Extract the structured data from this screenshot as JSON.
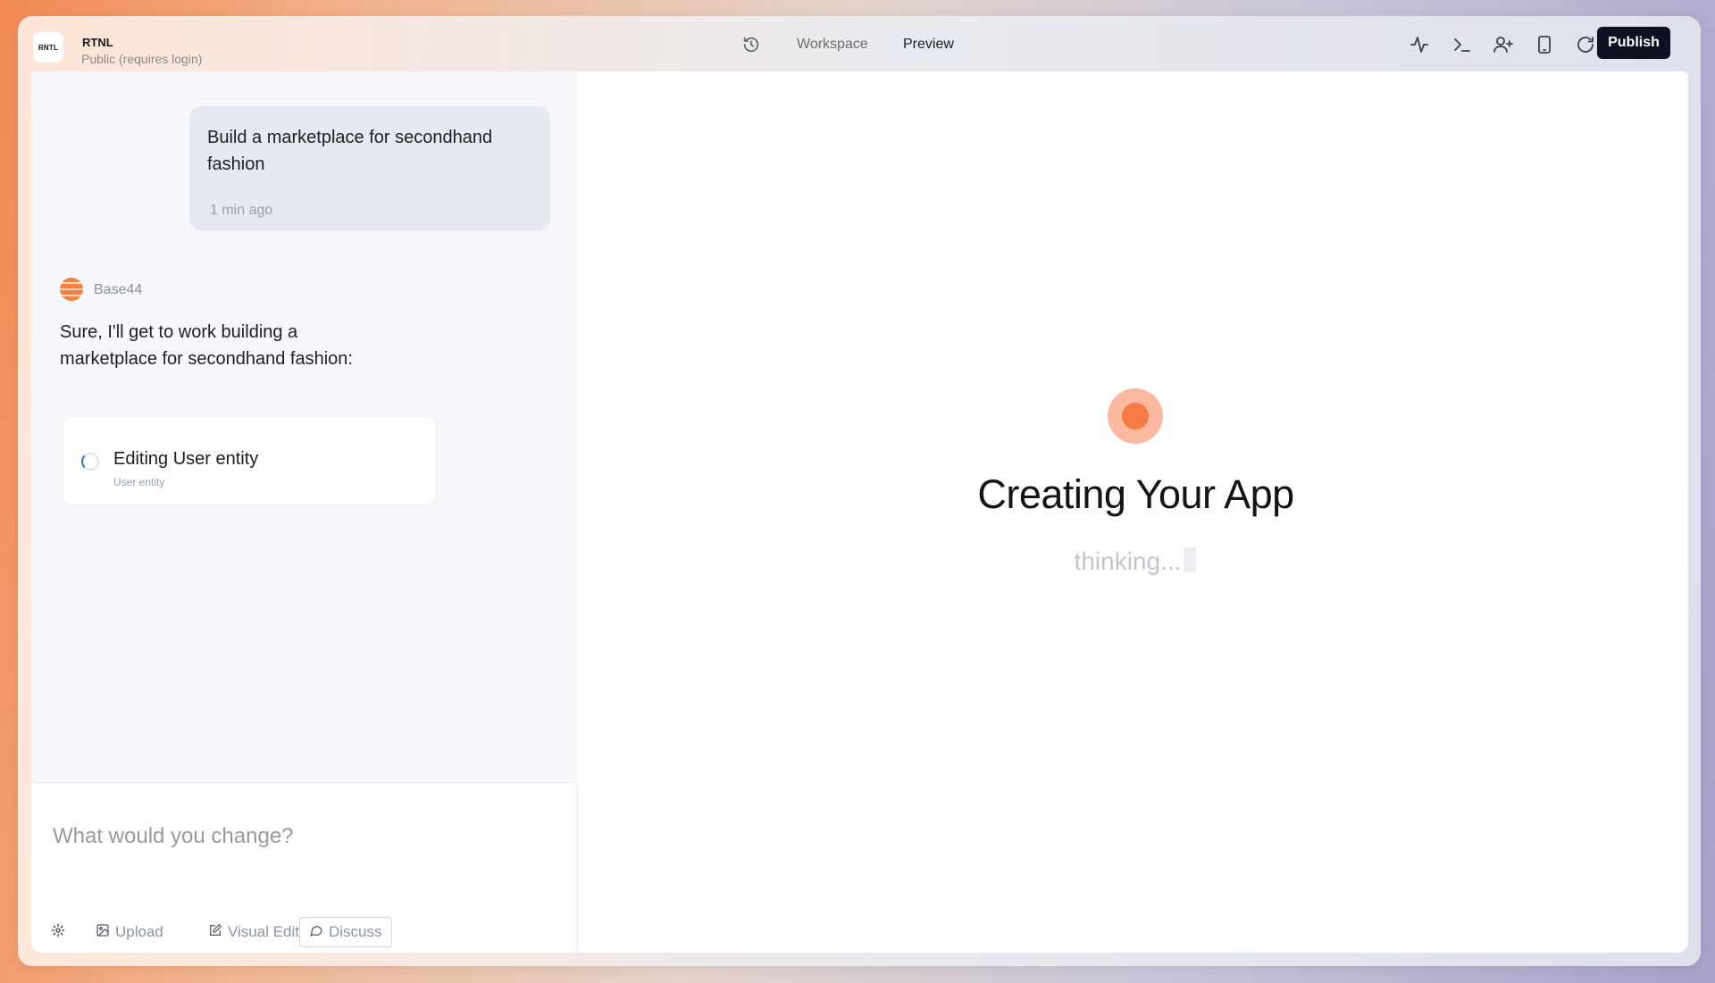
{
  "header": {
    "logo_text": "RNTL",
    "app_name": "RTNL",
    "visibility": "Public (requires login)",
    "tabs": [
      {
        "label": "Workspace",
        "active": false
      },
      {
        "label": "Preview",
        "active": true
      }
    ],
    "tools": [
      "activity-icon",
      "terminal-icon",
      "add-user-icon",
      "device-icon",
      "refresh-icon"
    ],
    "publish_label": "Publish"
  },
  "chat": {
    "user_message": {
      "text": "Build a marketplace for secondhand fashion",
      "time": "1 min ago"
    },
    "assistant": {
      "name": "Base44",
      "text": "Sure, I'll get to work building a marketplace for secondhand fashion:"
    },
    "task": {
      "title": "Editing User entity",
      "subtitle": "User entity",
      "status": "in-progress"
    }
  },
  "composer": {
    "placeholder": "What would you change?",
    "buttons": {
      "upload": "Upload",
      "visual_edit": "Visual Edit",
      "discuss": "Discuss"
    }
  },
  "preview": {
    "title": "Creating Your App",
    "status": "thinking..."
  },
  "colors": {
    "accent": "#f67a45",
    "publish_bg": "#0d1220"
  }
}
